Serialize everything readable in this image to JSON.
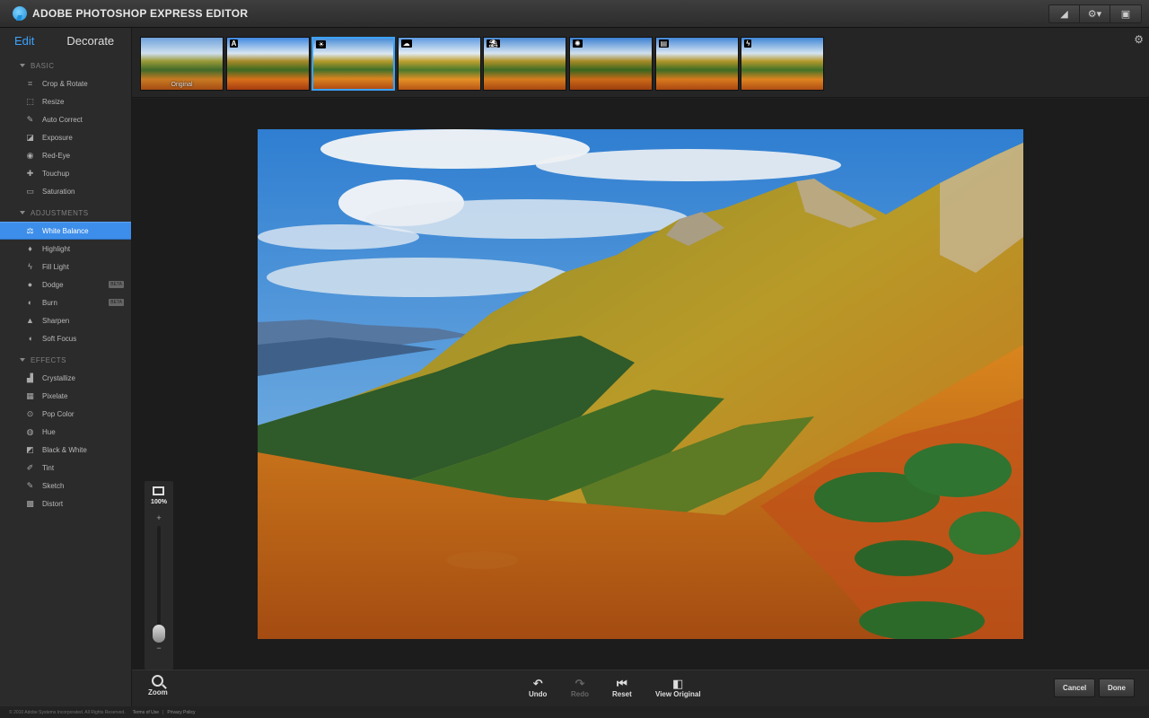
{
  "app": {
    "title": "ADOBE PHOTOSHOP EXPRESS EDITOR"
  },
  "titlebar_tools": [
    {
      "icon": "brush-icon",
      "glyph": "◢"
    },
    {
      "icon": "gear-menu-icon",
      "glyph": "⚙▾"
    },
    {
      "icon": "fullscreen-icon",
      "glyph": "▣"
    }
  ],
  "modes": {
    "edit": "Edit",
    "decorate": "Decorate"
  },
  "sections": [
    {
      "title": "BASIC",
      "items": [
        {
          "label": "Crop & Rotate",
          "icon": "crop-icon",
          "glyph": "⌗"
        },
        {
          "label": "Resize",
          "icon": "resize-icon",
          "glyph": "⬚"
        },
        {
          "label": "Auto Correct",
          "icon": "auto-correct-icon",
          "glyph": "✎"
        },
        {
          "label": "Exposure",
          "icon": "exposure-icon",
          "glyph": "◪"
        },
        {
          "label": "Red-Eye",
          "icon": "eye-icon",
          "glyph": "◉"
        },
        {
          "label": "Touchup",
          "icon": "bandage-icon",
          "glyph": "✚"
        },
        {
          "label": "Saturation",
          "icon": "saturation-icon",
          "glyph": "▭"
        }
      ]
    },
    {
      "title": "ADJUSTMENTS",
      "items": [
        {
          "label": "White Balance",
          "icon": "scale-icon",
          "glyph": "⚖",
          "active": true
        },
        {
          "label": "Highlight",
          "icon": "bulb-icon",
          "glyph": "♦"
        },
        {
          "label": "Fill Light",
          "icon": "lightning-icon",
          "glyph": "ϟ"
        },
        {
          "label": "Dodge",
          "icon": "dodge-icon",
          "glyph": "●",
          "beta": "BETA"
        },
        {
          "label": "Burn",
          "icon": "burn-icon",
          "glyph": "◐",
          "beta": "BETA"
        },
        {
          "label": "Sharpen",
          "icon": "triangle-icon",
          "glyph": "▲"
        },
        {
          "label": "Soft Focus",
          "icon": "drop-icon",
          "glyph": "◖"
        }
      ]
    },
    {
      "title": "EFFECTS",
      "items": [
        {
          "label": "Crystallize",
          "icon": "crystallize-icon",
          "glyph": "▟"
        },
        {
          "label": "Pixelate",
          "icon": "pixelate-icon",
          "glyph": "▦"
        },
        {
          "label": "Pop Color",
          "icon": "target-icon",
          "glyph": "⊙"
        },
        {
          "label": "Hue",
          "icon": "hue-icon",
          "glyph": "◍"
        },
        {
          "label": "Black & White",
          "icon": "bw-icon",
          "glyph": "◩"
        },
        {
          "label": "Tint",
          "icon": "pencil-icon",
          "glyph": "✐"
        },
        {
          "label": "Sketch",
          "icon": "sketch-icon",
          "glyph": "✎"
        },
        {
          "label": "Distort",
          "icon": "grid-icon",
          "glyph": "▩"
        }
      ]
    }
  ],
  "thumbnails": [
    {
      "caption": "Original",
      "badge": ""
    },
    {
      "caption": "",
      "badge": "A"
    },
    {
      "caption": "",
      "badge": "☀",
      "selected": true
    },
    {
      "caption": "",
      "badge": "☁"
    },
    {
      "caption": "",
      "badge": "⛱"
    },
    {
      "caption": "",
      "badge": "✺"
    },
    {
      "caption": "",
      "badge": "▤"
    },
    {
      "caption": "",
      "badge": "ϟ"
    }
  ],
  "zoom": {
    "percent": "100%",
    "plus": "+",
    "minus": "−",
    "label": "Zoom",
    "level": 0.0
  },
  "toolbar": {
    "undo": "Undo",
    "redo": "Redo",
    "reset": "Reset",
    "view_original": "View Original",
    "cancel": "Cancel",
    "done": "Done"
  },
  "footer": {
    "copyright": "© 2010 Adobe Systems Incorporated. All Rights Reserved.",
    "terms": "Terms of Use",
    "separator": "|",
    "privacy": "Privacy Policy"
  },
  "colors": {
    "accent": "#3d8eea",
    "selected_thumb": "#3ba3ff"
  }
}
